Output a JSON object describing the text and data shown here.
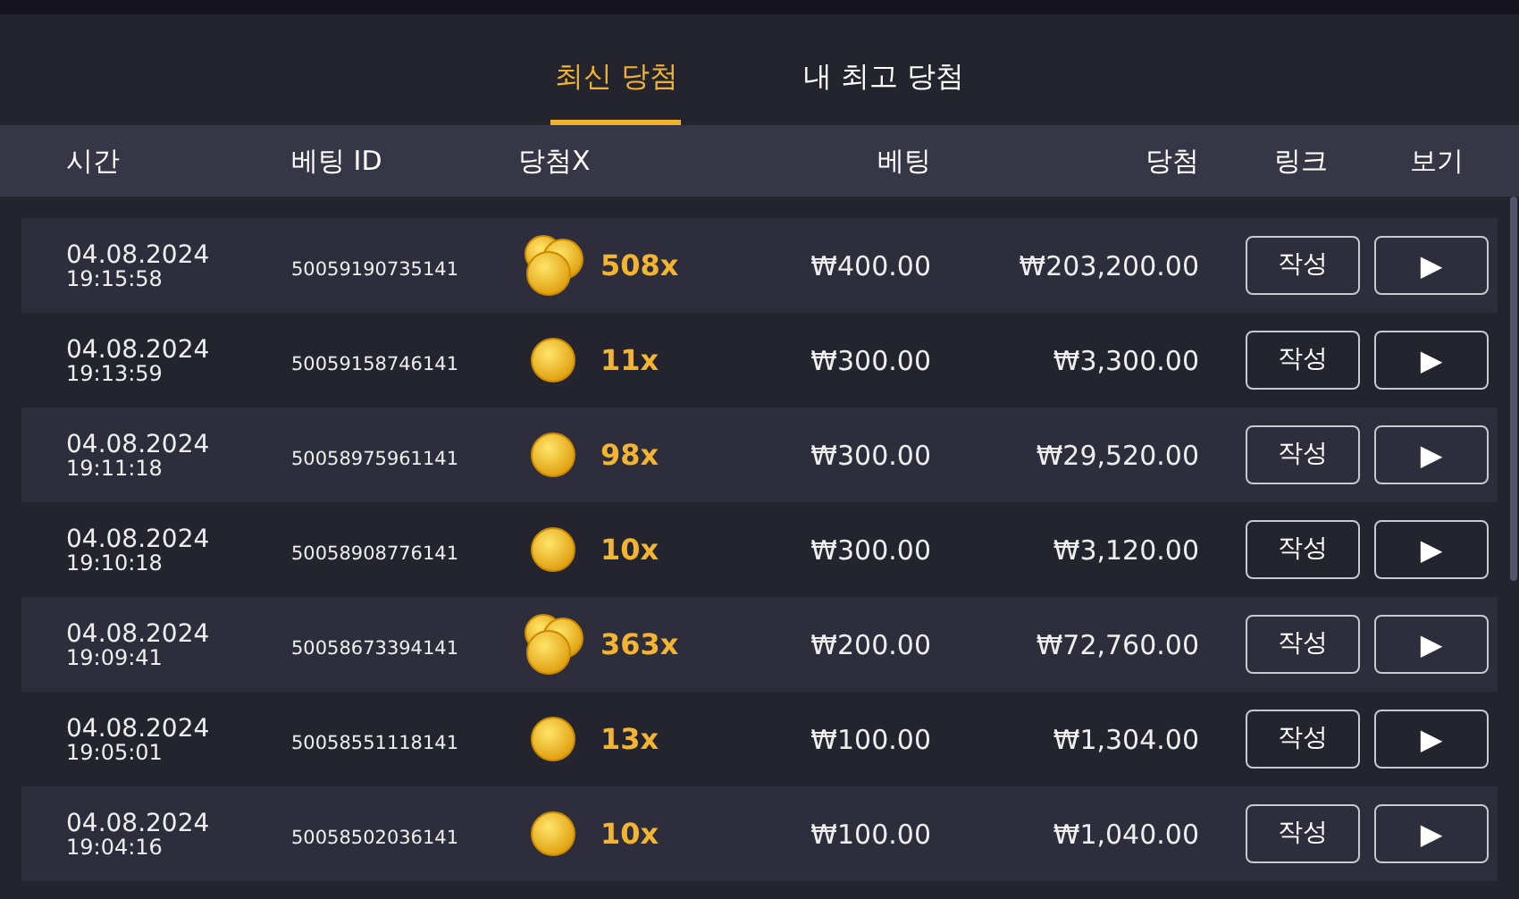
{
  "tabs": [
    {
      "label": "최신 당첨",
      "selected": true
    },
    {
      "label": "내 최고 당첨",
      "selected": false
    }
  ],
  "columns": [
    "시간",
    "베팅 ID",
    "당첨X",
    "베팅",
    "당첨",
    "링크",
    "보기"
  ],
  "rows": [
    {
      "date": "04.08.2024",
      "time": "19:15:58",
      "bet_id": "50059190735141",
      "kind": "pile",
      "multiplier": "508x",
      "bet": "₩400.00",
      "win": "₩203,200.00",
      "link_button": "작성",
      "view_button": "▶"
    },
    {
      "date": "04.08.2024",
      "time": "19:13:59",
      "bet_id": "50059158746141",
      "kind": "single",
      "multiplier": "11x",
      "bet": "₩300.00",
      "win": "₩3,300.00",
      "link_button": "작성",
      "view_button": "▶"
    },
    {
      "date": "04.08.2024",
      "time": "19:11:18",
      "bet_id": "50058975961141",
      "kind": "single",
      "multiplier": "98x",
      "bet": "₩300.00",
      "win": "₩29,520.00",
      "link_button": "작성",
      "view_button": "▶"
    },
    {
      "date": "04.08.2024",
      "time": "19:10:18",
      "bet_id": "50058908776141",
      "kind": "single",
      "multiplier": "10x",
      "bet": "₩300.00",
      "win": "₩3,120.00",
      "link_button": "작성",
      "view_button": "▶"
    },
    {
      "date": "04.08.2024",
      "time": "19:09:41",
      "bet_id": "50058673394141",
      "kind": "pile",
      "multiplier": "363x",
      "bet": "₩200.00",
      "win": "₩72,760.00",
      "link_button": "작성",
      "view_button": "▶"
    },
    {
      "date": "04.08.2024",
      "time": "19:05:01",
      "bet_id": "50058551118141",
      "kind": "single",
      "multiplier": "13x",
      "bet": "₩100.00",
      "win": "₩1,304.00",
      "link_button": "작성",
      "view_button": "▶"
    },
    {
      "date": "04.08.2024",
      "time": "19:04:16",
      "bet_id": "50058502036141",
      "kind": "single",
      "multiplier": "10x",
      "bet": "₩100.00",
      "win": "₩1,040.00",
      "link_button": "작성",
      "view_button": "▶"
    }
  ]
}
